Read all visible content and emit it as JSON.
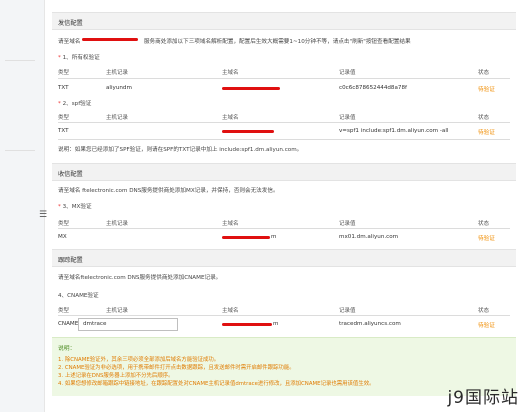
{
  "sections": {
    "send": {
      "title": "发信配置",
      "intro_prefix": "请至域名",
      "intro_suffix": "服务商处添加以下三项域名解析配置，配置后生效大概需要1~10分钟不等，请点击\"刷新\"按钮查看配置结果",
      "step1": {
        "star": "*",
        "label": "1、所有权验证"
      },
      "step2": {
        "star": "*",
        "label": "2、spf验证"
      },
      "headers": {
        "type": "类型",
        "host": "主机记录",
        "domain": "主域名",
        "value": "记录值",
        "status": "状态"
      },
      "row1": {
        "type": "TXT",
        "host": "aliyundm",
        "value": "c0c6c878652444d8a78f",
        "status": "待验证"
      },
      "row2": {
        "type": "TXT",
        "host": "",
        "value": "v=spf1 include:spf1.dm.aliyun.com -all",
        "status": "待验证"
      },
      "note": "说明：如果您已经添加了SPF验证，则请在SPF的TXT记录中加上 include:spf1.dm.aliyun.com。"
    },
    "receive": {
      "title": "收信配置",
      "intro": "请至域名 ftelectronic.com DNS服务提供商处添加MX记录，并保持，否则会无法发信。",
      "step3": {
        "star": "*",
        "label": "3、MX验证"
      },
      "headers": {
        "type": "类型",
        "host": "主机记录",
        "domain": "主域名",
        "value": "记录值",
        "status": "状态"
      },
      "row": {
        "type": "MX",
        "host": "",
        "domain_suffix": "m",
        "value": "mx01.dm.aliyun.com",
        "status": "待验证"
      }
    },
    "track": {
      "title": "跟踪配置",
      "intro": "请至域名ftelectronic.com DNS服务提供商处添加CNAME记录。",
      "step4": {
        "label": "4、CNAME验证"
      },
      "headers": {
        "type": "类型",
        "host": "主机记录",
        "domain": "主域名",
        "value": "记录值",
        "status": "状态"
      },
      "row": {
        "type": "CNAME",
        "host_input": "dmtrace",
        "domain_suffix": "m",
        "value": "tracedm.aliyuncs.com",
        "status": "待验证"
      }
    },
    "tips": {
      "title": "说明：",
      "lines": [
        "1. 除CNAME验证外，其余三项必须全部添加后域名方能验证成功。",
        "2. CNAME验证为非必选项，用于携带邮件打开点击数据跟踪，且发送邮件时需开启邮件跟踪功能。",
        "3. 上述记录在DNS服务器上添加不分先后顺序。",
        "4. 如果您想修改邮箱跟踪中链接地址，在跟踪配置处对CNAME主机记录值dmtrace进行修改，且添加CNAME记录也需用该值生效。"
      ]
    }
  },
  "watermark": "j9国际站",
  "colors": {
    "redaction": "#e01010",
    "status": "#f08c00",
    "tip_bg": "#eef8e4",
    "tip_text": "#e07b00"
  }
}
